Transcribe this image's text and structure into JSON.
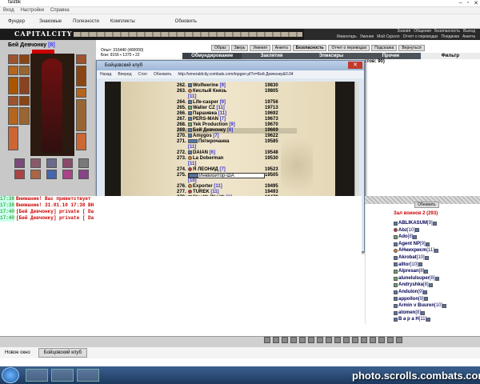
{
  "window": {
    "title": "fastbk"
  },
  "menubar": [
    "Вход",
    "Настройки",
    "Справка"
  ],
  "toolbar": [
    "Фундер",
    "Знакомые",
    "Полезности",
    "Комплекты",
    "Обновить"
  ],
  "game": {
    "logo": "CAPITALCITY",
    "topnav_row1": [
      "Знания",
      "Общение",
      "Безопасность",
      "Выход"
    ],
    "topnav_row2": [
      "Инвентарь",
      "Умения",
      "Мой Скролл",
      "Отчёт о переводах",
      "Поединки",
      "Анкета"
    ]
  },
  "character": {
    "name": "Бей Девчонку",
    "level": "[8]",
    "stats": [
      "Опыт: 316440 (400000)",
      "Бои: 9156 ▪ 1375 ▪ 22"
    ]
  },
  "actions": [
    "Образ",
    "Зверь",
    "Умения",
    "Анкета",
    "Безопасность",
    "Отчет о переводах",
    "Подсказка",
    "Вернуться"
  ],
  "tabs": [
    "Обмундирование",
    "Заклятия",
    "Эликсиры",
    "Прочее",
    "Фильтр"
  ],
  "subheader": "стов: 90)",
  "popup": {
    "title": "Бойцовский клуб",
    "nav": [
      "Назад",
      "Вперед",
      "Стоп",
      "Обновить"
    ],
    "url": "http://emeraldcity.combats.com/topgen.pl?n=Бей Девчонку&0.04",
    "rows": [
      {
        "n": "262.",
        "name": "Wolfwerine",
        "lv": "[9]",
        "score": "19830"
      },
      {
        "n": "263.",
        "name": "Кислый Князь",
        "lv": "",
        "score": "19805",
        "cont": "[11]"
      },
      {
        "n": "264.",
        "name": "Life-casper",
        "lv": "[9]",
        "score": "19756"
      },
      {
        "n": "265.",
        "name": "Walter CZ",
        "lv": "[11]",
        "score": "19713"
      },
      {
        "n": "266.",
        "name": "Паршивка",
        "lv": "[11]",
        "score": "19692"
      },
      {
        "n": "267.",
        "name": "PERS-MAN",
        "lv": "[7]",
        "score": "19673"
      },
      {
        "n": "268.",
        "name": "Yek Production",
        "lv": "[9]",
        "score": "19670"
      },
      {
        "n": "269.",
        "name": "Бей Девчонку",
        "lv": "[8]",
        "score": "19669"
      },
      {
        "n": "270.",
        "name": "Amygos",
        "lv": "[7]",
        "score": "19622"
      },
      {
        "n": "271.",
        "name": "Пятирочанка",
        "lv": "",
        "score": "19585",
        "cont": "[11]"
      },
      {
        "n": "272.",
        "name": "DAIAN",
        "lv": "[6]",
        "score": "19548"
      },
      {
        "n": "273.",
        "name": "La Doberman",
        "lv": "",
        "score": "19530",
        "cont": "[11]"
      },
      {
        "n": "274.",
        "name": "Я ЛЕОНИД",
        "lv": "[7]",
        "score": "19523"
      },
      {
        "n": "275.",
        "name": "Инквизитор-ША",
        "lv": "",
        "score": "19505",
        "cont": "[10]"
      },
      {
        "n": "276.",
        "name": "Exporter",
        "lv": "[11]",
        "score": "19495"
      },
      {
        "n": "277.",
        "name": "TUREK",
        "lv": "[11]",
        "score": "19493"
      },
      {
        "n": "278.",
        "name": "Stealth Wraith",
        "lv": "[6]",
        "score": "19479"
      }
    ]
  },
  "chat": [
    {
      "time": "17:38",
      "text": "Внимание! Вас приветствует"
    },
    {
      "time": "17:38",
      "text": "Внимание! 31.01.10 17:38 ВН"
    },
    {
      "time": "17:40",
      "text": "[Бей Девчонку] private [ Da"
    },
    {
      "time": "17:40",
      "text": "[Бей Девчонку] private [ Da"
    }
  ],
  "right": {
    "refresh": "Обновить",
    "room": "Зал воинов 2 (293)",
    "players": [
      {
        "name": "ABLIKASUM",
        "lv": "[9]"
      },
      {
        "name": "Abz",
        "lv": "[10]"
      },
      {
        "name": "Ado",
        "lv": "[8]"
      },
      {
        "name": "Agent NP",
        "lv": "[9]"
      },
      {
        "name": "AHнихрисm",
        "lv": "[11]"
      },
      {
        "name": "Akrobat",
        "lv": "[10]"
      },
      {
        "name": "alltor",
        "lv": "[10]"
      },
      {
        "name": "Alpresan",
        "lv": "[8]"
      },
      {
        "name": "alunelulsuper",
        "lv": "[8]"
      },
      {
        "name": "Andryshka",
        "lv": "[8]"
      },
      {
        "name": "Andulon",
        "lv": "[9]"
      },
      {
        "name": "appollon",
        "lv": "[9]"
      },
      {
        "name": "Armin v Buuren",
        "lv": "[10]"
      },
      {
        "name": "atomen",
        "lv": "[8]"
      },
      {
        "name": "В а р а Н",
        "lv": "[11]"
      }
    ]
  },
  "statusbar": [
    "Новое окно",
    "Бойцовский клуб"
  ],
  "watermark": "photo.scrolls.combats.com",
  "colors": {
    "header": "#1a1a1a",
    "tabs": "#4c5359",
    "parchment": "#f1e7cd",
    "warn": "#cc0000"
  }
}
